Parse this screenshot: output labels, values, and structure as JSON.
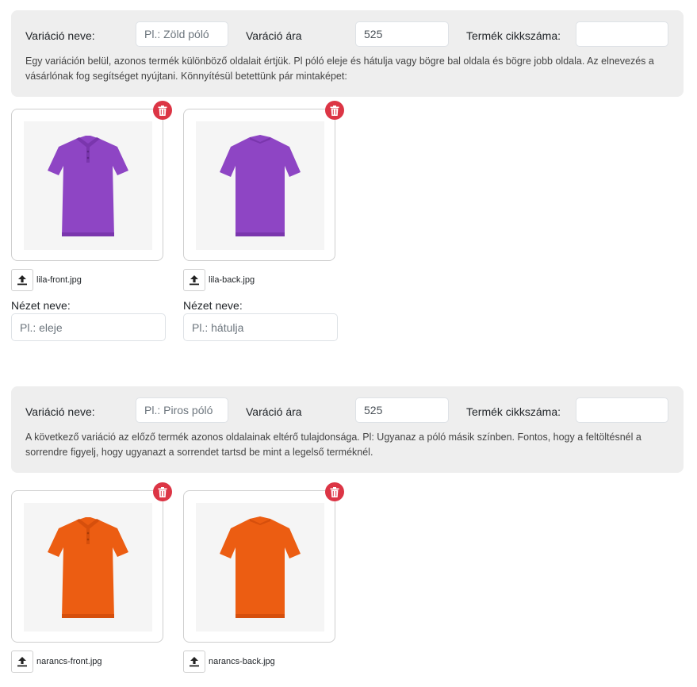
{
  "variations": [
    {
      "name_label": "Variáció neve:",
      "name_placeholder": "Pl.: Zöld póló",
      "price_label": "Varáció ára",
      "price_value": "525",
      "sku_label": "Termék cikkszáma:",
      "sku_value": "",
      "description": "Egy variáción belül, azonos termék különböző oldalait értjük. Pl póló eleje és hátulja vagy bögre bal oldala és bögre jobb oldala. Az elnevezés a vásárlónak fog segítséget nyújtani. Könnyítésül betettünk pár mintaképet:",
      "shirt_color": "#8e45c4",
      "shirt_shade": "#7a36ad",
      "images": [
        {
          "filename": "lila-front.jpg",
          "view_label": "Nézet neve:",
          "view_placeholder": "Pl.: eleje"
        },
        {
          "filename": "lila-back.jpg",
          "view_label": "Nézet neve:",
          "view_placeholder": "Pl.: hátulja"
        }
      ]
    },
    {
      "name_label": "Variáció neve:",
      "name_placeholder": "Pl.: Piros póló",
      "price_label": "Varáció ára",
      "price_value": "525",
      "sku_label": "Termék cikkszáma:",
      "sku_value": "",
      "description": "A következő variáció az előző termék azonos oldalainak eltérő tulajdonsága. Pl: Ugyanaz a póló másik színben. Fontos, hogy a feltöltésnél a sorrendre figyelj, hogy ugyanazt a sorrendet tartsd be mint a legelső terméknél.",
      "shirt_color": "#ec5d12",
      "shirt_shade": "#d64f0c",
      "images": [
        {
          "filename": "narancs-front.jpg"
        },
        {
          "filename": "narancs-back.jpg"
        }
      ]
    }
  ],
  "colors": {
    "panel_bg": "#eeeeee",
    "delete_red": "#dc3545"
  },
  "icons": {
    "delete": "trash-icon",
    "upload": "upload-icon"
  }
}
